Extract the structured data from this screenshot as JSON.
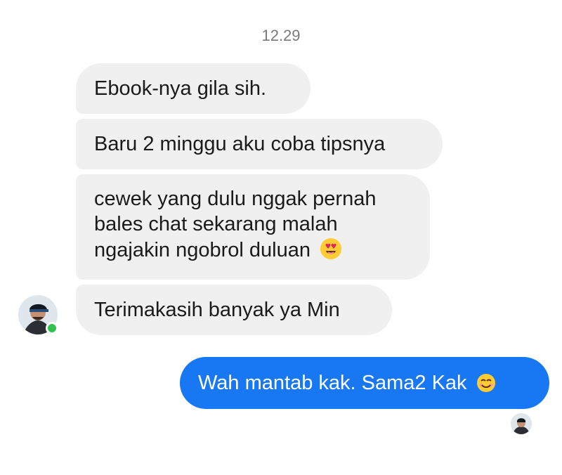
{
  "chat": {
    "timestamp": "12.29",
    "incoming_messages": [
      {
        "text": "Ebook-nya gila sih."
      },
      {
        "text": "Baru 2 minggu aku coba tipsnya"
      },
      {
        "lines": [
          "cewek yang dulu nggak pernah",
          "bales chat sekarang malah",
          "ngajakin ngobrol duluan"
        ],
        "emoji": "heart-eyes-emoji-icon"
      },
      {
        "text": "Terimakasih banyak ya Min"
      }
    ],
    "outgoing_message": {
      "text": "Wah mantab kak. Sama2 Kak",
      "emoji": "smiling-face-emoji-icon"
    },
    "sender_status": "online",
    "colors": {
      "incoming_bubble": "#f0f0f0",
      "outgoing_bubble": "#1877f2",
      "timestamp": "#7a7a7a",
      "online_dot": "#31c24d"
    }
  }
}
